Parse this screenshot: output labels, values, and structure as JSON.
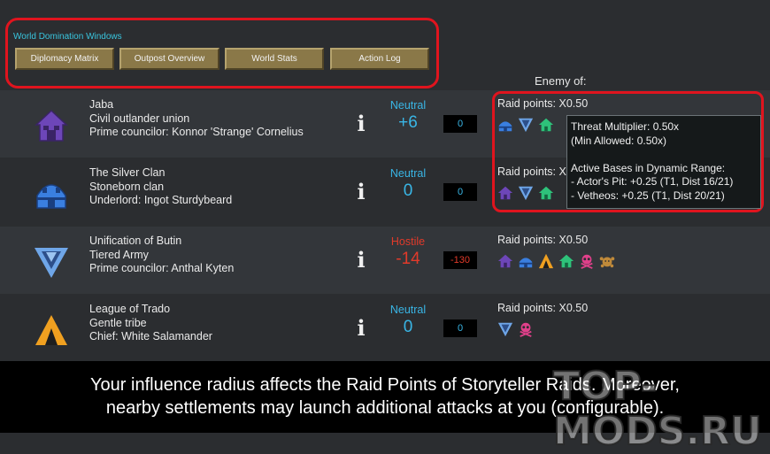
{
  "windows": {
    "title": "World Domination Windows",
    "buttons": [
      "Diplomacy Matrix",
      "Outpost Overview",
      "World Stats",
      "Action Log"
    ]
  },
  "enemy_of_label": "Enemy of:",
  "factions": [
    {
      "name": "Jaba",
      "type": "Civil outlander union",
      "leader": "Prime councilor: Konnor 'Strange' Cornelius",
      "icon": "purple-house-icon",
      "relation": "Neutral",
      "relation_value": "+6",
      "pill": "0",
      "raid": "Raid points: X0.50",
      "raid_icons": [
        "blue-dome-icon",
        "blue-v-icon",
        "green-house-icon"
      ]
    },
    {
      "name": "The Silver Clan",
      "type": "Stoneborn clan",
      "leader": "Underlord: Ingot Sturdybeard",
      "icon": "blue-dome-icon",
      "relation": "Neutral",
      "relation_value": "0",
      "pill": "0",
      "raid": "Raid points: X",
      "raid_icons": [
        "purple-house-icon",
        "blue-v-icon",
        "green-house-icon"
      ]
    },
    {
      "name": "Unification of Butin",
      "type": "Tiered Army",
      "leader": "Prime councilor: Anthal Kyten",
      "icon": "blue-v-icon",
      "relation": "Hostile",
      "relation_value": "-14",
      "pill": "-130",
      "raid": "Raid points: X0.50",
      "raid_icons": [
        "purple-house-icon",
        "blue-dome-icon",
        "orange-tent-icon",
        "green-house-icon",
        "pink-skull-icon",
        "orange-beast-icon"
      ]
    },
    {
      "name": "League of Trado",
      "type": "Gentle tribe",
      "leader": "Chief: White Salamander",
      "icon": "orange-tent-icon",
      "relation": "Neutral",
      "relation_value": "0",
      "pill": "0",
      "raid": "Raid points: X0.50",
      "raid_icons": [
        "blue-v-icon",
        "pink-skull-icon"
      ]
    }
  ],
  "tooltip": {
    "lines": [
      "Threat Multiplier: 0.50x",
      "(Min Allowed: 0.50x)",
      "",
      "Active Bases in Dynamic Range:",
      "- Actor's Pit: +0.25 (T1, Dist 16/21)",
      "- Vetheos: +0.25 (T1, Dist 20/21)"
    ]
  },
  "caption": {
    "line1": "Your influence radius affects the Raid Points of Storyteller Raids. Moreover,",
    "line2": "nearby settlements may launch additional attacks at you (configurable)."
  },
  "watermark": "TOP-MODS.RU",
  "colors": {
    "neutral": "#39b6e6",
    "hostile": "#e23a2a",
    "highlight": "#e0141e",
    "button": "#8a7848"
  }
}
